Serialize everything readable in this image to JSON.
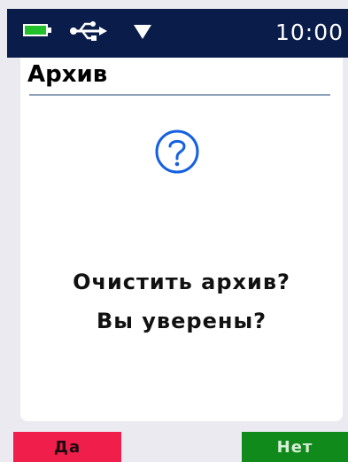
{
  "status_bar": {
    "time": "10:00",
    "battery_icon": "battery-full-icon",
    "usb_icon": "usb-icon",
    "signal_icon": "signal-down-icon",
    "battery_color": "#22c02a",
    "background": "#0a1c4a"
  },
  "screen": {
    "title": "Архив",
    "icon": "question-circle-icon",
    "icon_color": "#1560e0",
    "message_line1": "Очистить архив?",
    "message_line2": "Вы уверены?"
  },
  "softkeys": {
    "yes_label": "Да",
    "yes_color": "#f01e4a",
    "no_label": "Нет",
    "no_color": "#108a1a"
  }
}
